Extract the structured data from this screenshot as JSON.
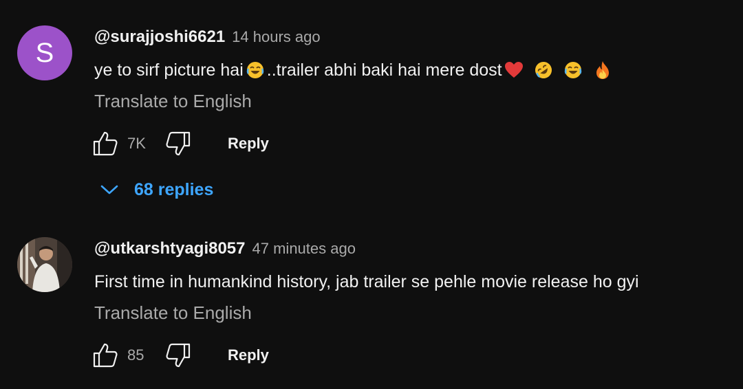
{
  "comments": [
    {
      "avatar_letter": "S",
      "avatar_color": "#9c52c9",
      "handle": "@surajjoshi6621",
      "time": "14 hours ago",
      "text_part1": "ye to sirf picture hai",
      "text_part2": "..trailer abhi baki hai mere dost",
      "emojis": [
        "joy-emoji",
        "red-heart-emoji",
        "rofl-emoji",
        "joy-emoji",
        "fire-emoji"
      ],
      "translate_label": "Translate to English",
      "likes": "7K",
      "reply_label": "Reply",
      "replies_label": "68 replies"
    },
    {
      "avatar_type": "photo",
      "handle": "@utkarshtyagi8057",
      "time": "47 minutes ago",
      "text": "First time in humankind history, jab trailer se pehle movie release ho gyi",
      "translate_label": "Translate to English",
      "likes": "85",
      "reply_label": "Reply"
    }
  ],
  "colors": {
    "background": "#0f0f0f",
    "primary_text": "#f1f1f1",
    "secondary_text": "#aaaaaa",
    "link_blue": "#3ea6ff"
  }
}
